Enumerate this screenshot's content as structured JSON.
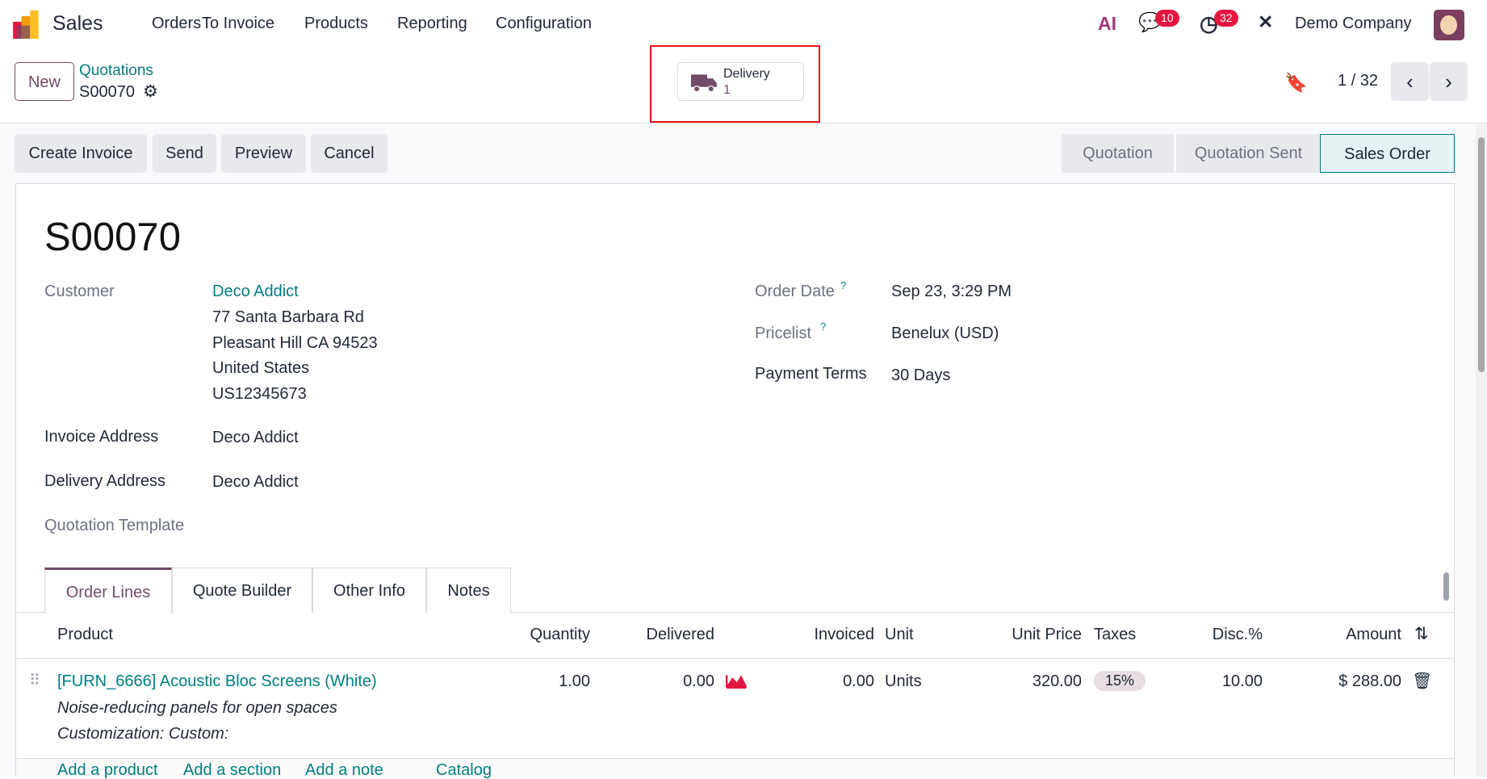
{
  "nav": {
    "app": "Sales",
    "menu": [
      "Orders",
      "To Invoice",
      "Products",
      "Reporting",
      "Configuration"
    ],
    "messages_count": "10",
    "activities_count": "32",
    "company": "Demo Company",
    "ai_label": "AI"
  },
  "control": {
    "new_label": "New",
    "breadcrumb": "Quotations",
    "record": "S00070",
    "delivery_label": "Delivery",
    "delivery_count": "1",
    "pager": "1 / 32"
  },
  "actions": [
    "Create Invoice",
    "Send",
    "Preview",
    "Cancel"
  ],
  "statusbar": {
    "steps": [
      "Quotation",
      "Quotation Sent",
      "Sales Order"
    ],
    "active": "Sales Order"
  },
  "form": {
    "title": "S00070",
    "customer_label": "Customer",
    "customer": "Deco Addict",
    "address": [
      "77 Santa Barbara Rd",
      "Pleasant Hill CA 94523",
      "United States",
      "US12345673"
    ],
    "invoice_address_label": "Invoice Address",
    "invoice_address": "Deco Addict",
    "delivery_address_label": "Delivery Address",
    "delivery_address": "Deco Addict",
    "template_label": "Quotation Template",
    "order_date_label": "Order Date",
    "order_date": "Sep 23, 3:29 PM",
    "pricelist_label": "Pricelist",
    "pricelist": "Benelux (USD)",
    "payment_terms_label": "Payment Terms",
    "payment_terms": "30 Days",
    "help": "?"
  },
  "tabs": [
    "Order Lines",
    "Quote Builder",
    "Other Info",
    "Notes"
  ],
  "table": {
    "headers": [
      "Product",
      "Quantity",
      "Delivered",
      "Invoiced",
      "Unit",
      "Unit Price",
      "Taxes",
      "Disc.%",
      "Amount"
    ],
    "rows": [
      {
        "product": "[FURN_6666] Acoustic Bloc Screens (White)",
        "desc1": "Noise-reducing panels for open spaces",
        "desc2": "Customization: Custom:",
        "quantity": "1.00",
        "delivered": "0.00",
        "invoiced": "0.00",
        "unit": "Units",
        "unit_price": "320.00",
        "taxes": "15%",
        "discount": "10.00",
        "amount": "$ 288.00"
      }
    ],
    "add_links": [
      "Add a product",
      "Add a section",
      "Add a note",
      "Catalog"
    ]
  }
}
